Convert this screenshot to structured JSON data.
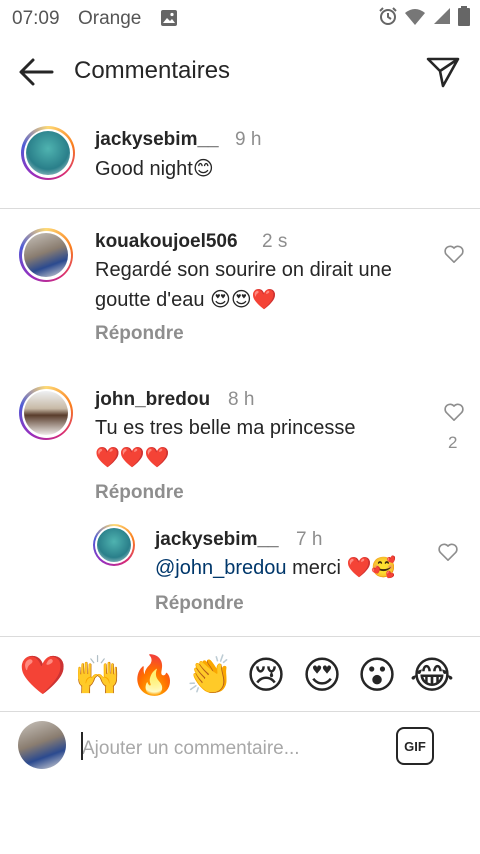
{
  "status_bar": {
    "time": "07:09",
    "carrier": "Orange"
  },
  "header": {
    "title": "Commentaires",
    "back_icon": "back-arrow-icon",
    "send_icon": "paper-plane-icon"
  },
  "caption": {
    "username": "jackysebim__",
    "time": "9 h",
    "text": "Good night😊"
  },
  "comments": [
    {
      "username": "kouakoujoel506",
      "time": "2 s",
      "line1": "Regardé son sourire on dirait une",
      "line2": "goutte d'eau 😍😍❤️",
      "reply_label": "Répondre",
      "likes": ""
    },
    {
      "username": "john_bredou",
      "time": "8 h",
      "line1": "Tu es tres belle ma princesse",
      "line2": "❤️❤️❤️",
      "reply_label": "Répondre",
      "likes": "2"
    }
  ],
  "replies": [
    {
      "username": "jackysebim__",
      "time": "7 h",
      "mention": "@john_bredou",
      "text": " merci ❤️🥰",
      "reply_label": "Répondre"
    }
  ],
  "emoji_bar": [
    "❤️",
    "🙌",
    "🔥",
    "👏",
    "😢",
    "😍",
    "😮",
    "😂"
  ],
  "composer": {
    "placeholder": "Ajouter un commentaire...",
    "gif_label": "GIF"
  },
  "colors": {
    "accent_link": "#00376b",
    "muted": "#8e8e8e",
    "heart_red": "#ed4956"
  }
}
